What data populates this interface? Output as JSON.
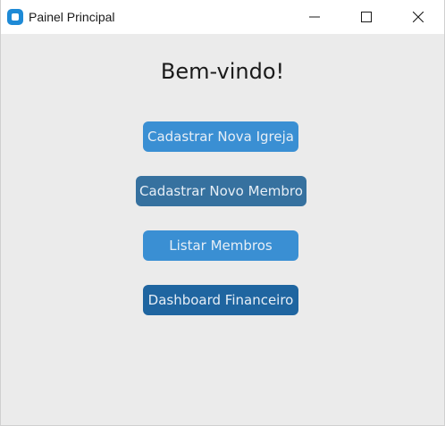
{
  "window": {
    "title": "Painel Principal",
    "controls": {
      "minimize_icon": "minimize-icon",
      "maximize_icon": "maximize-icon",
      "close_icon": "close-icon"
    }
  },
  "main": {
    "heading": "Bem-vindo!",
    "buttons": [
      {
        "label": "Cadastrar Nova Igreja",
        "color": "#3a8fd3"
      },
      {
        "label": "Cadastrar Novo Membro",
        "color": "#36719f"
      },
      {
        "label": "Listar Membros",
        "color": "#3a8fd3"
      },
      {
        "label": "Dashboard Financeiro",
        "color": "#1f65a0"
      }
    ]
  },
  "colors": {
    "background": "#ebebeb",
    "titlebar": "#ffffff",
    "app_icon": "#1e8ad6",
    "button_text": "#e6eef6"
  }
}
